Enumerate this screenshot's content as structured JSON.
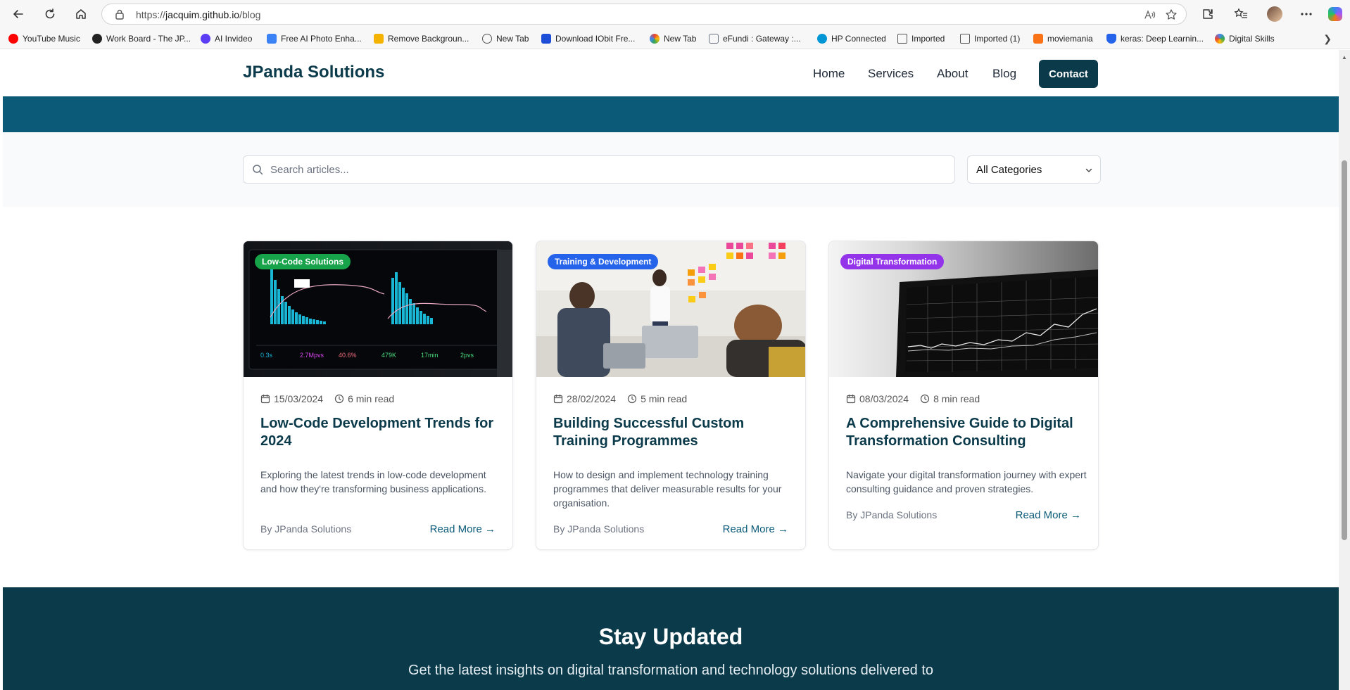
{
  "browser": {
    "url_prefix": "https://",
    "url_host": "jacquim.github.io",
    "url_path": "/blog",
    "bookmarks": [
      {
        "label": "YouTube Music",
        "color": "#ff0000"
      },
      {
        "label": "Work Board - The JP...",
        "color": "#222222"
      },
      {
        "label": "AI Invideo",
        "color": "#5b3df5"
      },
      {
        "label": "Free AI Photo Enha...",
        "color": "#3b82f6"
      },
      {
        "label": "Remove Backgroun...",
        "color": "#f5b301"
      },
      {
        "label": "New Tab",
        "color": "#555555"
      },
      {
        "label": "Download IObit Fre...",
        "color": "#1d4ed8"
      },
      {
        "label": "New Tab",
        "color": "#ea4335"
      },
      {
        "label": "eFundi : Gateway :...",
        "color": "#6b7280"
      },
      {
        "label": "HP Connected",
        "color": "#0096d6"
      },
      {
        "label": "Imported",
        "color": "#6b7280"
      },
      {
        "label": "Imported (1)",
        "color": "#6b7280"
      },
      {
        "label": "moviemania",
        "color": "#f97316"
      },
      {
        "label": "keras: Deep Learnin...",
        "color": "#2563eb"
      },
      {
        "label": "Digital Skills",
        "color": "#4285f4"
      }
    ]
  },
  "site": {
    "logo": "JPanda Solutions",
    "nav": [
      "Home",
      "Services",
      "About",
      "Blog"
    ],
    "contact_label": "Contact"
  },
  "search": {
    "placeholder": "Search articles...",
    "category_value": "All Categories"
  },
  "posts": [
    {
      "category": "Low-Code Solutions",
      "badge_color": "#16a34a",
      "date": "15/03/2024",
      "read_time": "6 min read",
      "title": "Low-Code Development Trends for 2024",
      "excerpt": "Exploring the latest trends in low-code development and how they're transforming business applications.",
      "author": "By JPanda Solutions",
      "read_more": "Read More →"
    },
    {
      "category": "Training & Development",
      "badge_color": "#2563eb",
      "date": "28/02/2024",
      "read_time": "5 min read",
      "title": "Building Successful Custom Training Programmes",
      "excerpt": "How to design and implement technology training programmes that deliver measurable results for your organisation.",
      "author": "By JPanda Solutions",
      "read_more": "Read More →"
    },
    {
      "category": "Digital Transformation",
      "badge_color": "#9333ea",
      "date": "08/03/2024",
      "read_time": "8 min read",
      "title": "A Comprehensive Guide to Digital Transformation Consulting",
      "excerpt": "Navigate your digital transformation journey with expert consulting guidance and proven strategies.",
      "author": "By JPanda Solutions",
      "read_more": "Read More →"
    }
  ],
  "newsletter": {
    "title": "Stay Updated",
    "subtitle": "Get the latest insights on digital transformation and technology solutions delivered to"
  },
  "colors": {
    "brand_dark": "#0b3a4a",
    "brand_band": "#0b5a78"
  }
}
